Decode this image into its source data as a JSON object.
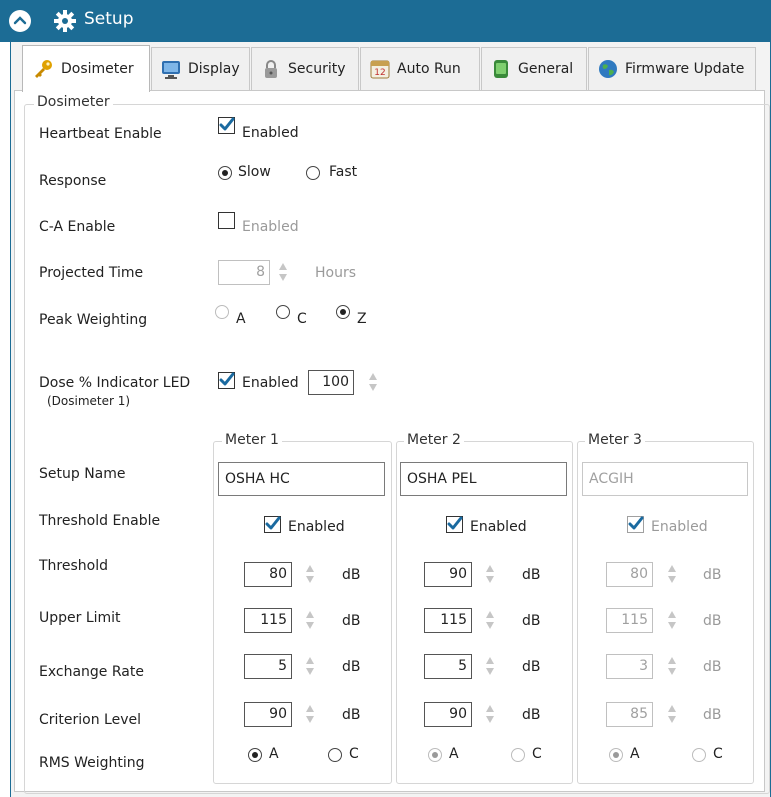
{
  "window": {
    "title": "Setup"
  },
  "tabs": [
    {
      "label": "Dosimeter",
      "icon": "key-icon"
    },
    {
      "label": "Display",
      "icon": "monitor-icon"
    },
    {
      "label": "Security",
      "icon": "padlock-icon"
    },
    {
      "label": "Auto Run",
      "icon": "calendar-icon"
    },
    {
      "label": "General",
      "icon": "device-icon"
    },
    {
      "label": "Firmware Update",
      "icon": "globe-icon"
    }
  ],
  "dosimeter": {
    "group_title": "Dosimeter",
    "heartbeat": {
      "label": "Heartbeat Enable",
      "checkbox": "Enabled",
      "checked": true
    },
    "response": {
      "label": "Response",
      "options": [
        "Slow",
        "Fast"
      ],
      "selected": "Slow"
    },
    "ca_enable": {
      "label": "C-A Enable",
      "checkbox": "Enabled",
      "checked": false
    },
    "projected_time": {
      "label": "Projected Time",
      "value": "8",
      "unit": "Hours"
    },
    "peak_weighting": {
      "label": "Peak Weighting",
      "options": [
        "A",
        "C",
        "Z"
      ],
      "selected": "Z"
    },
    "dose_led": {
      "label": "Dose % Indicator LED",
      "sublabel": "(Dosimeter 1)",
      "checkbox": "Enabled",
      "checked": true,
      "value": "100"
    }
  },
  "meter_rows": {
    "setup_name": "Setup Name",
    "threshold_enable": "Threshold Enable",
    "threshold": "Threshold",
    "upper_limit": "Upper Limit",
    "exchange_rate": "Exchange Rate",
    "criterion_level": "Criterion Level",
    "rms_weighting": "RMS Weighting"
  },
  "meters": [
    {
      "title": "Meter 1",
      "name": "OSHA HC",
      "threshold_enabled": "Enabled",
      "threshold": "80",
      "upper_limit": "115",
      "exchange_rate": "5",
      "criterion": "90",
      "unit": "dB",
      "rms_options": [
        "A",
        "C"
      ],
      "rms_selected": "A",
      "enabled": true
    },
    {
      "title": "Meter 2",
      "name": "OSHA PEL",
      "threshold_enabled": "Enabled",
      "threshold": "90",
      "upper_limit": "115",
      "exchange_rate": "5",
      "criterion": "90",
      "unit": "dB",
      "rms_options": [
        "A",
        "C"
      ],
      "rms_selected": "A",
      "enabled": true
    },
    {
      "title": "Meter 3",
      "name": "ACGIH",
      "threshold_enabled": "Enabled",
      "threshold": "80",
      "upper_limit": "115",
      "exchange_rate": "3",
      "criterion": "85",
      "unit": "dB",
      "rms_options": [
        "A",
        "C"
      ],
      "rms_selected": "A",
      "enabled": false
    }
  ],
  "colors": {
    "titlebar": "#1c6c95",
    "check": "#1a6aa0"
  }
}
